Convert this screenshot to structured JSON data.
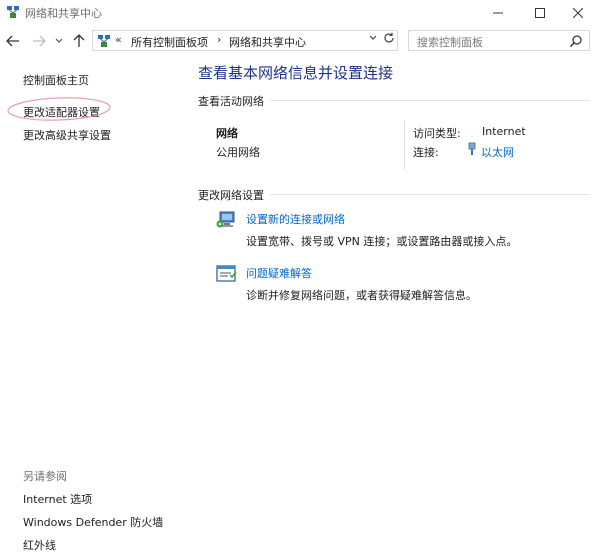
{
  "window": {
    "title": "网络和共享中心"
  },
  "address_bar": {
    "prefix": "«",
    "crumbs": [
      "所有控制面板项",
      "网络和共享中心"
    ],
    "separator": "›",
    "search_placeholder": "搜索控制面板"
  },
  "left_pane": {
    "home": "控制面板主页",
    "adapter": "更改适配器设置",
    "advanced_sharing": "更改高级共享设置",
    "see_also_title": "另请参阅",
    "see_also": [
      "Internet 选项",
      "Windows Defender 防火墙",
      "红外线"
    ]
  },
  "main": {
    "title": "查看基本网络信息并设置连接",
    "active_networks_label": "查看活动网络",
    "network_name": "网络",
    "network_category": "公用网络",
    "access_type_label": "访问类型:",
    "access_type_value": "Internet",
    "connections_label": "连接:",
    "connection_value": "以太网",
    "change_settings_label": "更改网络设置",
    "tasks": [
      {
        "link": "设置新的连接或网络",
        "desc": "设置宽带、拨号或 VPN 连接；或设置路由器或接入点。",
        "icon": "new-connection-icon"
      },
      {
        "link": "问题疑难解答",
        "desc": "诊断并修复网络问题，或者获得疑难解答信息。",
        "icon": "troubleshoot-icon"
      }
    ]
  },
  "colors": {
    "title_blue": "#1e3287",
    "link_blue": "#0066cc",
    "annotation_red": "#e8a0a8"
  }
}
